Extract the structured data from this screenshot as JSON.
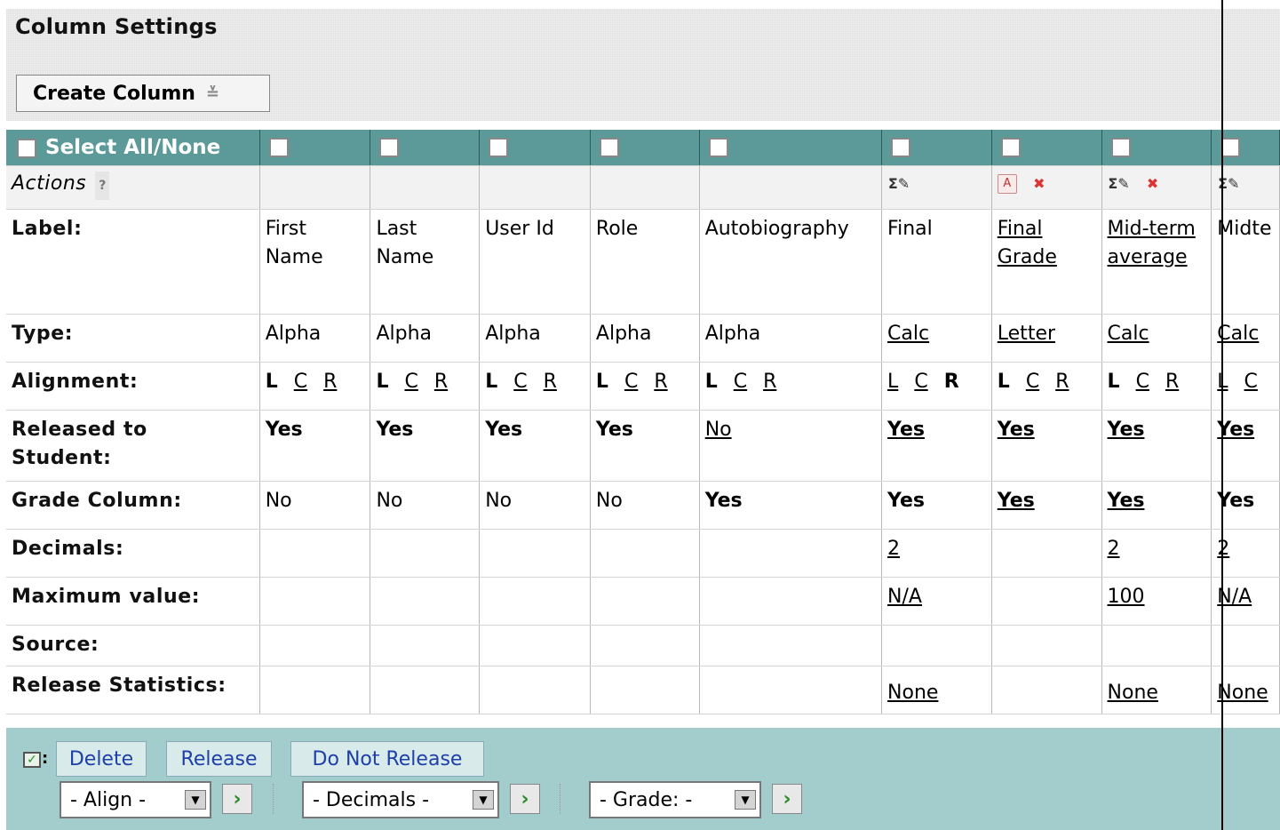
{
  "page": {
    "title": "Column Settings",
    "create_column_label": "Create Column"
  },
  "select_all_label": "Select All/None",
  "actions_label": "Actions",
  "actions_help": "?",
  "row_labels": {
    "label": "Label:",
    "type": "Type:",
    "alignment": "Alignment:",
    "released": "Released to Student:",
    "grade_column": "Grade Column:",
    "decimals": "Decimals:",
    "max": "Maximum value:",
    "source": "Source:",
    "release_stats": "Release Statistics:"
  },
  "alignment_letters": [
    "L",
    "C",
    "R"
  ],
  "columns": [
    {
      "label": "First Name",
      "type": "Alpha",
      "released": "Yes",
      "grade": "No",
      "decimals": "",
      "max": "",
      "stats": ""
    },
    {
      "label": "Last Name",
      "type": "Alpha",
      "released": "Yes",
      "grade": "No",
      "decimals": "",
      "max": "",
      "stats": ""
    },
    {
      "label": "User Id",
      "type": "Alpha",
      "released": "Yes",
      "grade": "No",
      "decimals": "",
      "max": "",
      "stats": ""
    },
    {
      "label": "Role",
      "type": "Alpha",
      "released": "Yes",
      "grade": "No",
      "decimals": "",
      "max": "",
      "stats": ""
    },
    {
      "label": "Autobiography",
      "type": "Alpha",
      "released": "No",
      "grade": "Yes",
      "decimals": "",
      "max": "",
      "stats": ""
    },
    {
      "label": "Final",
      "type": "Calc",
      "released": "Yes",
      "grade": "Yes",
      "decimals": "2",
      "max": "N/A",
      "stats": "None"
    },
    {
      "label": "Final Grade",
      "type": "Letter",
      "released": "Yes",
      "grade": "Yes",
      "decimals": "",
      "max": "",
      "stats": ""
    },
    {
      "label": "Mid-term average",
      "type": "Calc",
      "released": "Yes",
      "grade": "Yes",
      "decimals": "2",
      "max": "100",
      "stats": "None"
    },
    {
      "label": "Midte",
      "type": "Calc",
      "released": "Yes",
      "grade": "Yes",
      "decimals": "2",
      "max": "N/A",
      "stats": "None"
    }
  ],
  "bottom": {
    "delete": "Delete",
    "release": "Release",
    "do_not_release": "Do Not Release",
    "align_select": "- Align -",
    "decimals_select": "- Decimals -",
    "grade_select": "- Grade: -"
  },
  "icons": [
    "calc-edit-icon",
    "letter-edit-icon",
    "delete-column-icon",
    "go-arrow-icon",
    "dropdown-arrow-icon",
    "checkbox-icon",
    "menu-icon",
    "help-icon"
  ]
}
